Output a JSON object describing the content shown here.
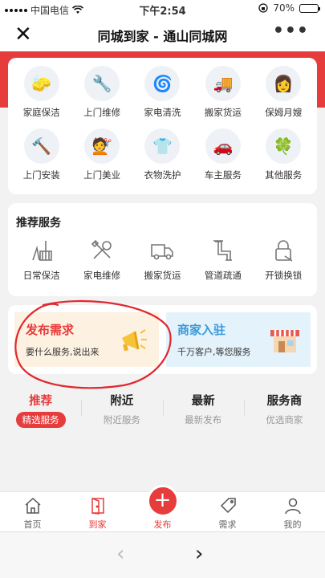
{
  "status_bar": {
    "carrier": "中国电信",
    "time": "下午2:54",
    "battery": "70%",
    "battery_level": 0.7
  },
  "nav": {
    "close_glyph": "✕",
    "title": "同城到家 - 通山同城网",
    "more_glyph": "•••"
  },
  "grid": [
    {
      "label": "家庭保洁",
      "icon": "cleaning-icon",
      "glyph": "🧽"
    },
    {
      "label": "上门维修",
      "icon": "wrench-icon",
      "glyph": "🔧"
    },
    {
      "label": "家电清洗",
      "icon": "washing-machine-icon",
      "glyph": "🌀"
    },
    {
      "label": "搬家货运",
      "icon": "truck-icon",
      "glyph": "🚚"
    },
    {
      "label": "保姆月嫂",
      "icon": "nanny-icon",
      "glyph": "👩"
    },
    {
      "label": "上门安装",
      "icon": "hammer-icon",
      "glyph": "🔨"
    },
    {
      "label": "上门美业",
      "icon": "beauty-icon",
      "glyph": "💇"
    },
    {
      "label": "衣物洗护",
      "icon": "shirt-icon",
      "glyph": "👕"
    },
    {
      "label": "车主服务",
      "icon": "car-icon",
      "glyph": "🚗"
    },
    {
      "label": "其他服务",
      "icon": "clover-icon",
      "glyph": "🍀"
    }
  ],
  "recommend": {
    "heading": "推荐服务",
    "items": [
      {
        "label": "日常保洁",
        "icon": "broom-icon"
      },
      {
        "label": "家电维修",
        "icon": "tools-icon"
      },
      {
        "label": "搬家货运",
        "icon": "truck-outline-icon"
      },
      {
        "label": "管道疏通",
        "icon": "pipe-icon"
      },
      {
        "label": "开锁换锁",
        "icon": "lock-icon"
      }
    ]
  },
  "promo": {
    "left": {
      "title": "发布需求",
      "subtitle": "要什么服务,说出来",
      "icon": "megaphone-icon"
    },
    "right": {
      "title": "商家入驻",
      "subtitle": "千万客户,等您服务",
      "icon": "shop-icon"
    }
  },
  "tabs": [
    {
      "title": "推荐",
      "subtitle": "精选服务",
      "active": true
    },
    {
      "title": "附近",
      "subtitle": "附近服务",
      "active": false
    },
    {
      "title": "最新",
      "subtitle": "最新发布",
      "active": false
    },
    {
      "title": "服务商",
      "subtitle": "优选商家",
      "active": false
    }
  ],
  "bottom_nav": [
    {
      "label": "首页",
      "icon": "home-icon"
    },
    {
      "label": "到家",
      "icon": "door-icon"
    },
    {
      "label": "发布",
      "icon": "plus-icon"
    },
    {
      "label": "需求",
      "icon": "tag-icon"
    },
    {
      "label": "我的",
      "icon": "user-icon"
    }
  ],
  "browser": {
    "back_glyph": "‹",
    "forward_glyph": "›"
  },
  "colors": {
    "accent": "#e63c3c",
    "blue": "#3a9ad9",
    "annotation": "#e0282f"
  }
}
